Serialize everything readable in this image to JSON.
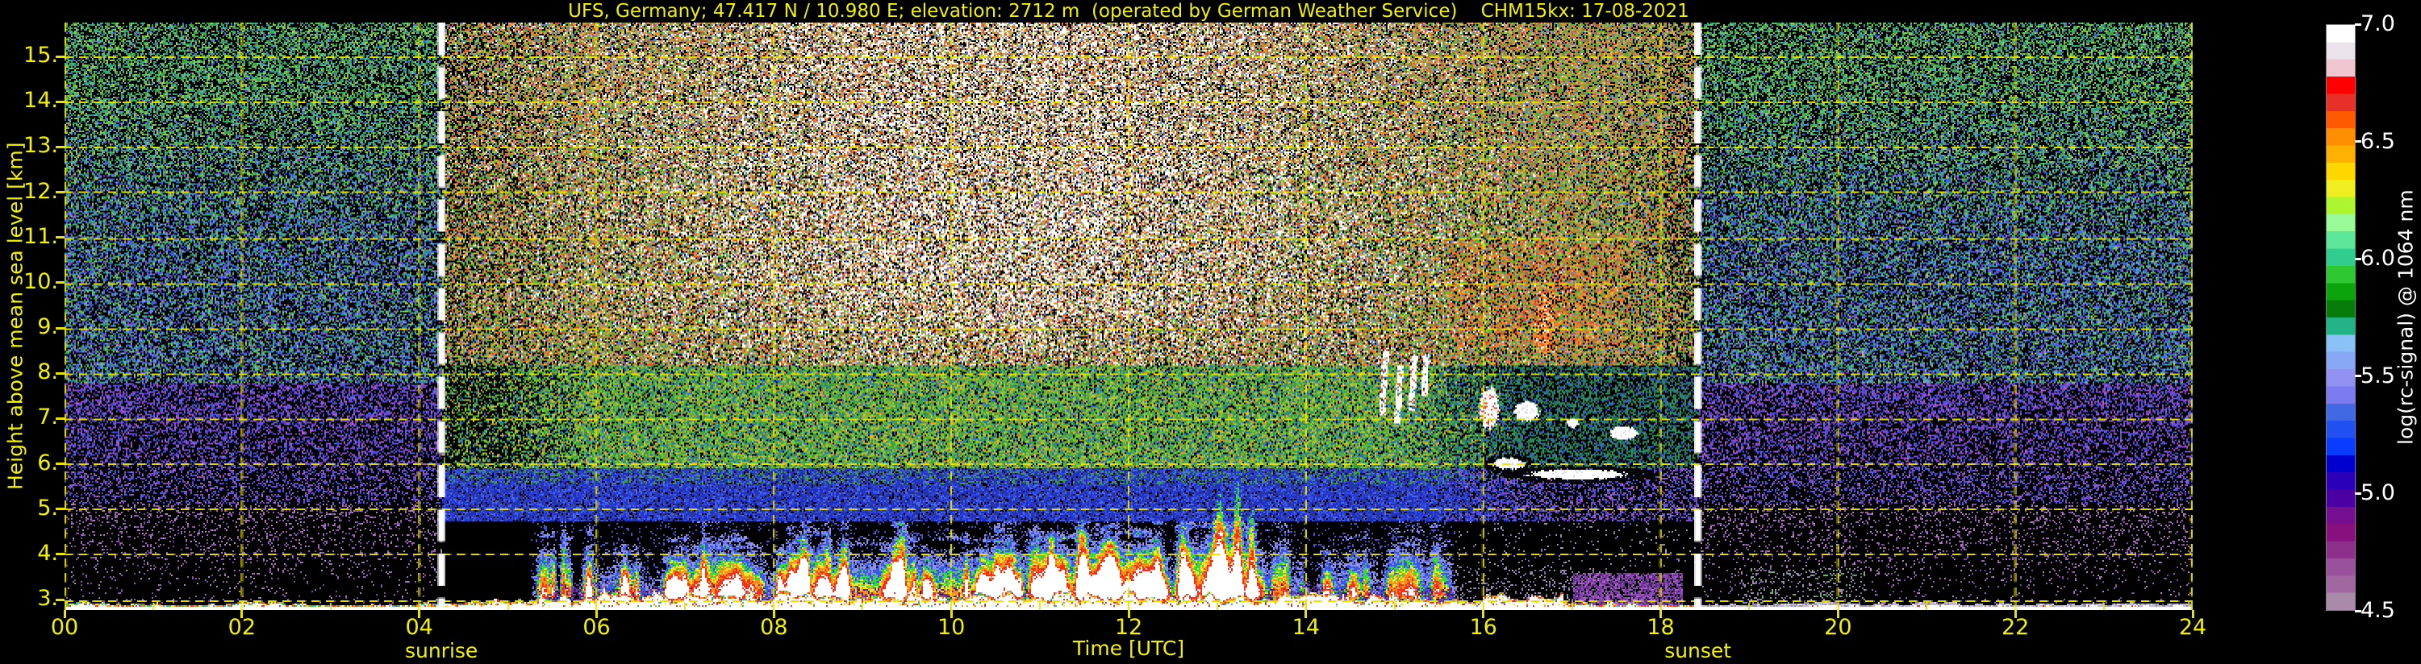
{
  "title": "UFS, Germany; 47.417 N / 10.980 E; elevation: 2712 m  (operated by German Weather Service)    CHM15kx: 17-08-2021",
  "station": {
    "name": "UFS",
    "country": "Germany",
    "lat": "47.417 N",
    "lon": "10.980 E",
    "elevation": "2712 m",
    "operator": "German Weather Service",
    "instrument": "CHM15kx",
    "date": "17-08-2021"
  },
  "axes": {
    "x": {
      "label": "Time [UTC]",
      "ticks": [
        "00",
        "02",
        "04",
        "06",
        "08",
        "10",
        "12",
        "14",
        "16",
        "18",
        "20",
        "22",
        "24"
      ],
      "range": [
        0,
        24
      ]
    },
    "y": {
      "label": "Height above mean sea level [km]",
      "ticks": [
        "15.",
        "14.",
        "13.",
        "12.",
        "11.",
        "10.",
        "9.",
        "8.",
        "7.",
        "6.",
        "5.",
        "4.",
        "3."
      ],
      "range_km": [
        2.77,
        15.75
      ]
    }
  },
  "markers": {
    "sunrise": {
      "label": "sunrise",
      "time_utc": 4.25,
      "time_text": "04:15"
    },
    "sunset": {
      "label": "sunset",
      "time_utc": 18.42,
      "time_text": "18:25"
    }
  },
  "colorbar": {
    "label": "log(rc-signal) @ 1064 nm",
    "ticks": [
      "7.0",
      "6.5",
      "6.0",
      "5.5",
      "5.0",
      "4.5"
    ],
    "range": [
      4.5,
      7.0
    ],
    "colors": [
      "#ffffff",
      "#ebe3eb",
      "#f0c6d0",
      "#fe0000",
      "#e63028",
      "#fe5a00",
      "#fe9000",
      "#ffb000",
      "#ffd700",
      "#eeee20",
      "#adf52f",
      "#98fb98",
      "#5ce69a",
      "#30cd8e",
      "#2ec832",
      "#0ca40c",
      "#087c08",
      "#22b286",
      "#8ac2f8",
      "#88a8f6",
      "#9292f2",
      "#7c7cf0",
      "#4169e1",
      "#2050f0",
      "#0a3cff",
      "#0000cd",
      "#2a00b8",
      "#4c00a4",
      "#760e90",
      "#870f7e",
      "#8b2f8b",
      "#99519b",
      "#a1689f",
      "#a98aa9"
    ]
  },
  "style": {
    "grid_color": "#e8e400",
    "marker_color": "#ffffff",
    "axis_text_color": "#f2f200",
    "cb_text_color": "#ffffff",
    "background": "#000000"
  },
  "chart_data": {
    "type": "heatmap",
    "title": "UFS, Germany; 47.417 N / 10.980 E; elevation: 2712 m (operated by German Weather Service) CHM15kx: 17-08-2021",
    "xlabel": "Time [UTC]",
    "ylabel": "Height above mean sea level [km]",
    "x_range_hours": [
      0,
      24
    ],
    "y_range_km": [
      2.77,
      15.75
    ],
    "value_label": "log(rc-signal) @ 1064 nm",
    "value_range": [
      4.5,
      7.0
    ],
    "sunrise_utc": "04:15",
    "sunset_utc": "18:25",
    "grid": "yellow dashed every 2 h and every 1 km",
    "features": {
      "surface_return_km": 2.85,
      "day_noise": "bright white/brown/red solar background speckle above ~8 km between sunrise and sunset, strongest 08-14 UTC",
      "night_noise": "green/teal/blue speckle above ~8 km, purple-blue 5-8 km, sparse mauve below 5 km",
      "boundary_layer_plumes": {
        "time_utc": [
          5.3,
          15.65
        ],
        "base_km": 3.1,
        "top_km_typical": [
          3.8,
          4.8
        ],
        "colors": "blue-green-yellow-red-white cores"
      },
      "tall_plumes": [
        [
          13.02,
          6.3
        ],
        [
          13.22,
          6.6
        ],
        [
          13.38,
          5.9
        ],
        [
          11.45,
          5.4
        ],
        [
          9.45,
          5.2
        ],
        [
          12.6,
          5.3
        ]
      ],
      "white_streaks": [
        [
          14.85,
          7.1,
          8.6
        ],
        [
          15.02,
          6.9,
          8.2
        ],
        [
          15.18,
          7.2,
          8.4
        ],
        [
          15.32,
          7.5,
          8.45
        ]
      ],
      "cloud_blobs": [
        [
          16.06,
          7.25,
          0.1,
          0.42,
          "red"
        ],
        [
          16.48,
          7.18,
          0.13,
          0.2,
          ""
        ],
        [
          17.0,
          6.92,
          0.06,
          0.1,
          ""
        ],
        [
          17.58,
          6.7,
          0.15,
          0.13,
          ""
        ],
        [
          16.28,
          6.02,
          0.17,
          0.12,
          "halo"
        ],
        [
          17.05,
          5.78,
          0.5,
          0.1,
          "halo"
        ]
      ],
      "orange_virga": {
        "t": [
          16.55,
          16.95
        ],
        "h": [
          8.25,
          10.05
        ]
      },
      "orange_patch": {
        "t": [
          15.6,
          17.6
        ],
        "h": [
          8.6,
          10.9
        ]
      },
      "purple_band": {
        "t": [
          17.0,
          18.25
        ],
        "h_top": 3.6
      },
      "mauve_zone": {
        "t": [
          15.68,
          17.0
        ],
        "h_top": 4.35
      },
      "gray_patch_after_sunset": {
        "t": [
          18.9,
          20.3
        ],
        "h_top": 3.7
      }
    },
    "render": {
      "seed": 42,
      "random_plumes": {
        "count": 95,
        "t_min": 5.3,
        "t_max": 15.62,
        "w_min": 0.025,
        "w_max": 0.095,
        "top_min": 3.75,
        "top_max": 4.75,
        "s_min": 0.5,
        "s_max": 1.15
      },
      "plume_boosters": [
        [
          11.3,
          0.3,
          4.35,
          0.8
        ],
        [
          12.0,
          0.25,
          4.45,
          0.85
        ],
        [
          9.0,
          0.3,
          4.2,
          0.7
        ],
        [
          7.5,
          0.35,
          4.15,
          0.6
        ],
        [
          6.3,
          0.3,
          4.0,
          0.5
        ],
        [
          10.0,
          0.3,
          4.3,
          0.7
        ],
        [
          14.5,
          0.3,
          4.3,
          0.42
        ],
        [
          15.2,
          0.2,
          4.5,
          0.5
        ],
        [
          12.9,
          0.25,
          4.6,
          0.95
        ],
        [
          13.15,
          0.2,
          4.4,
          0.9
        ],
        [
          13.7,
          0.18,
          4.5,
          0.35
        ],
        [
          14.95,
          0.12,
          4.0,
          0.32
        ]
      ],
      "plume_specials": [
        [
          13.02,
          0.075,
          6.3,
          1.25
        ],
        [
          13.22,
          0.06,
          6.6,
          1.3
        ],
        [
          13.38,
          0.05,
          5.9,
          1.15
        ],
        [
          11.45,
          0.05,
          5.4,
          1.1
        ],
        [
          9.45,
          0.05,
          5.2,
          1.15
        ],
        [
          12.6,
          0.06,
          5.3,
          1.1
        ],
        [
          5.62,
          0.035,
          4.95,
          1.0
        ],
        [
          8.6,
          0.04,
          5.0,
          1.05
        ]
      ],
      "plume_tiers": [
        "#ffffff",
        "#f03020",
        "#ff8c1e",
        "#ffe02a",
        "#38d838",
        "#3858e8",
        "#8a92ee",
        "#4a50c8"
      ],
      "salt": {
        "white": "#ffffff",
        "tan1": "#c89a64",
        "tan2": "#a87848",
        "red": "#d84a30",
        "orange": "#e8822c",
        "yellow": "#d8c840",
        "green": "#5aae38",
        "ygreen": "#9cc838",
        "blue": "#5a7ce0",
        "pink": "#e8b0a8"
      },
      "palettes": {
        "night_high_g": [
          [
            40,
            "#3fa43f"
          ],
          [
            18,
            "#66c85a"
          ],
          [
            16,
            "#a8cc3a"
          ],
          [
            16,
            "#2f9f86"
          ],
          [
            10,
            "#38b0c0"
          ]
        ],
        "night_high_b": [
          [
            45,
            "#3c5cd8"
          ],
          [
            20,
            "#6f8fe8"
          ],
          [
            15,
            "#2f9f86"
          ],
          [
            12,
            "#8a3ec8"
          ],
          [
            8,
            "#66c85a"
          ]
        ],
        "night_mid": [
          [
            30,
            "#4a44d0"
          ],
          [
            20,
            "#6a50e0"
          ],
          [
            28,
            "#8a48c0"
          ],
          [
            12,
            "#b060c8"
          ],
          [
            10,
            "#3a6ae0"
          ]
        ],
        "night_low": [
          [
            50,
            "#9a62b2"
          ],
          [
            28,
            "#7a4a9a"
          ],
          [
            22,
            "#b284c4"
          ]
        ],
        "night_gray": [
          [
            55,
            "#9a8aae"
          ],
          [
            30,
            "#7a6a9a"
          ],
          [
            15,
            "#58c858"
          ]
        ],
        "day_green": [
          [
            30,
            "#3f9f3f"
          ],
          [
            20,
            "#5fbe3a"
          ],
          [
            16,
            "#9cc838"
          ],
          [
            9,
            "#d8c030"
          ],
          [
            6,
            "#e08828"
          ],
          [
            12,
            "#2a6ad0"
          ],
          [
            7,
            "#35897f"
          ]
        ],
        "day_green_fade": [
          [
            40,
            "#2f8f5f"
          ],
          [
            25,
            "#27754a"
          ],
          [
            20,
            "#3a5ad8"
          ],
          [
            15,
            "#206858"
          ]
        ],
        "day_navy": [
          [
            38,
            "#2030c0"
          ],
          [
            28,
            "#3048e0"
          ],
          [
            16,
            "#4a66ee"
          ],
          [
            18,
            "#28388f"
          ]
        ],
        "purple_base": [
          [
            45,
            "#5a2a80"
          ],
          [
            30,
            "#7a3a9a"
          ],
          [
            25,
            "#3a1a5a"
          ]
        ],
        "purple_band": [
          [
            45,
            "#8a4ab0"
          ],
          [
            28,
            "#6a3290"
          ],
          [
            15,
            "#b062cc"
          ],
          [
            12,
            "#4a2268"
          ]
        ],
        "mauve_cols": [
          [
            55,
            "#9a8ab0"
          ],
          [
            30,
            "#7a6a9a"
          ],
          [
            15,
            "#b0a0c0"
          ]
        ],
        "streak_orange": [
          [
            33,
            "#ff7a20"
          ],
          [
            25,
            "#e84818"
          ],
          [
            20,
            "#ffb050"
          ],
          [
            12,
            "#ffffff"
          ],
          [
            10,
            "#ffd898"
          ]
        ],
        "fuzz_day": [
          [
            30,
            "#f03020"
          ],
          [
            25,
            "#ff9020"
          ],
          [
            12,
            "#ffe030"
          ],
          [
            8,
            "#30c830"
          ],
          [
            7,
            "#30a8e8"
          ],
          [
            18,
            "#ffffff"
          ]
        ],
        "fuzz_night": [
          [
            18,
            "#f03020"
          ],
          [
            16,
            "#ff9020"
          ],
          [
            16,
            "#ffe030"
          ],
          [
            18,
            "#30c830"
          ],
          [
            16,
            "#30a8e8"
          ],
          [
            16,
            "#ffffff"
          ]
        ],
        "fuzz_gray": [
          [
            60,
            "#c0b8cc"
          ],
          [
            25,
            "#9a8aae"
          ],
          [
            15,
            "#e8e0f0"
          ]
        ]
      }
    }
  }
}
